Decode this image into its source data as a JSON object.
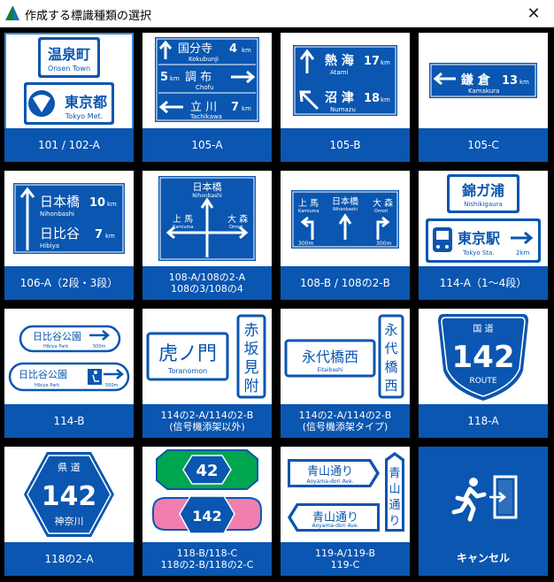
{
  "window": {
    "title": "作成する標識種類の選択",
    "close_label": "✕"
  },
  "tiles": [
    {
      "caption": "101 / 102-A"
    },
    {
      "caption": "105-A"
    },
    {
      "caption": "105-B"
    },
    {
      "caption": "105-C"
    },
    {
      "caption": "106-A（2段・3段）"
    },
    {
      "caption": "108-A/108の2-A\n108の3/108の4"
    },
    {
      "caption": "108-B / 108の2-B"
    },
    {
      "caption": "114-A（1〜4段）"
    },
    {
      "caption": "114-B"
    },
    {
      "caption": "114の2-A/114の2-B\n(信号機添架以外)"
    },
    {
      "caption": "114の2-A/114の2-B\n(信号機添架タイプ)"
    },
    {
      "caption": "118-A"
    },
    {
      "caption": "118の2-A"
    },
    {
      "caption": "118-B/118-C\n118の2-B/118の2-C"
    },
    {
      "caption": "119-A/119-B\n119-C"
    },
    {
      "caption": "キャンセル"
    }
  ],
  "signs": {
    "s101": {
      "top_jp": "温泉町",
      "top_en": "Onsen Town",
      "bot_jp": "東京都",
      "bot_en": "Tokyo Met."
    },
    "s105a": {
      "r1_jp": "国分寺",
      "r1_dist": "4",
      "r1_en": "Kokubunji",
      "r2_jp": "調 布",
      "r2_dist": "5",
      "r2_en": "Chofu",
      "r3_jp": "立 川",
      "r3_dist": "7",
      "r3_en": "Tachikawa",
      "unit": "km"
    },
    "s105b": {
      "r1_jp": "熱 海",
      "r1_dist": "17",
      "r1_en": "Atami",
      "r2_jp": "沼 津",
      "r2_dist": "18",
      "r2_en": "Numazu",
      "unit": "km"
    },
    "s105c": {
      "jp": "鎌 倉",
      "dist": "13",
      "en": "Kamakura",
      "unit": "km"
    },
    "s106a": {
      "r1_jp": "日本橋",
      "r1_dist": "10",
      "r1_en": "Nihonbashi",
      "r2_jp": "日比谷",
      "r2_dist": "7",
      "r2_en": "Hibiya",
      "unit": "km"
    },
    "s108a": {
      "top_jp": "日本橋",
      "top_en": "Nihonbashi",
      "left_jp": "上 馬",
      "left_en": "Kamiuma",
      "right_jp": "大 森",
      "right_en": "Omori"
    },
    "s108b": {
      "left_jp": "上 馬",
      "left_en": "Kamiuma",
      "mid_jp": "日本橋",
      "mid_en": "Nihonbashi",
      "right_jp": "大 森",
      "right_en": "Omori",
      "dist_l": "300m",
      "dist_r": "300m"
    },
    "s114a": {
      "top_jp": "錦ガ浦",
      "top_en": "Nishikigaura",
      "bot_jp": "東京駅",
      "bot_en": "Tokyo Sta.",
      "bot_dist": "2km"
    },
    "s114b": {
      "r1_jp": "日比谷公園",
      "r1_en": "Hibiya Park",
      "r1_dist": "500m",
      "r2_jp": "日比谷公園",
      "r2_en": "Hibiya Park",
      "r2_dist": "500m"
    },
    "s114c": {
      "jp": "虎ノ門",
      "en": "Toranomon",
      "v1": "赤",
      "v2": "坂",
      "v3": "見",
      "v4": "附"
    },
    "s114d": {
      "jp": "永代橋西",
      "en": "Eitaibashi",
      "v1": "永",
      "v2": "代",
      "v3": "橋",
      "v4": "西"
    },
    "s118a": {
      "top": "国 道",
      "num": "142",
      "bottom": "ROUTE"
    },
    "s1182a": {
      "top": "県 道",
      "num": "142",
      "bottom": "神奈川"
    },
    "s118b": {
      "num1": "42",
      "num2": "142"
    },
    "s119": {
      "r1_jp": "青山通り",
      "r1_en": "Aoyama-dori Ave.",
      "r2_jp": "青山通り",
      "r2_en": "Aoyama-dori Ave.",
      "v1": "青",
      "v2": "山",
      "v3": "通",
      "v4": "り"
    }
  },
  "colors": {
    "sign_blue": "#0a56b0",
    "caption_blue": "#0a56b0",
    "green": "#00a54f",
    "pink": "#f07fb0"
  }
}
